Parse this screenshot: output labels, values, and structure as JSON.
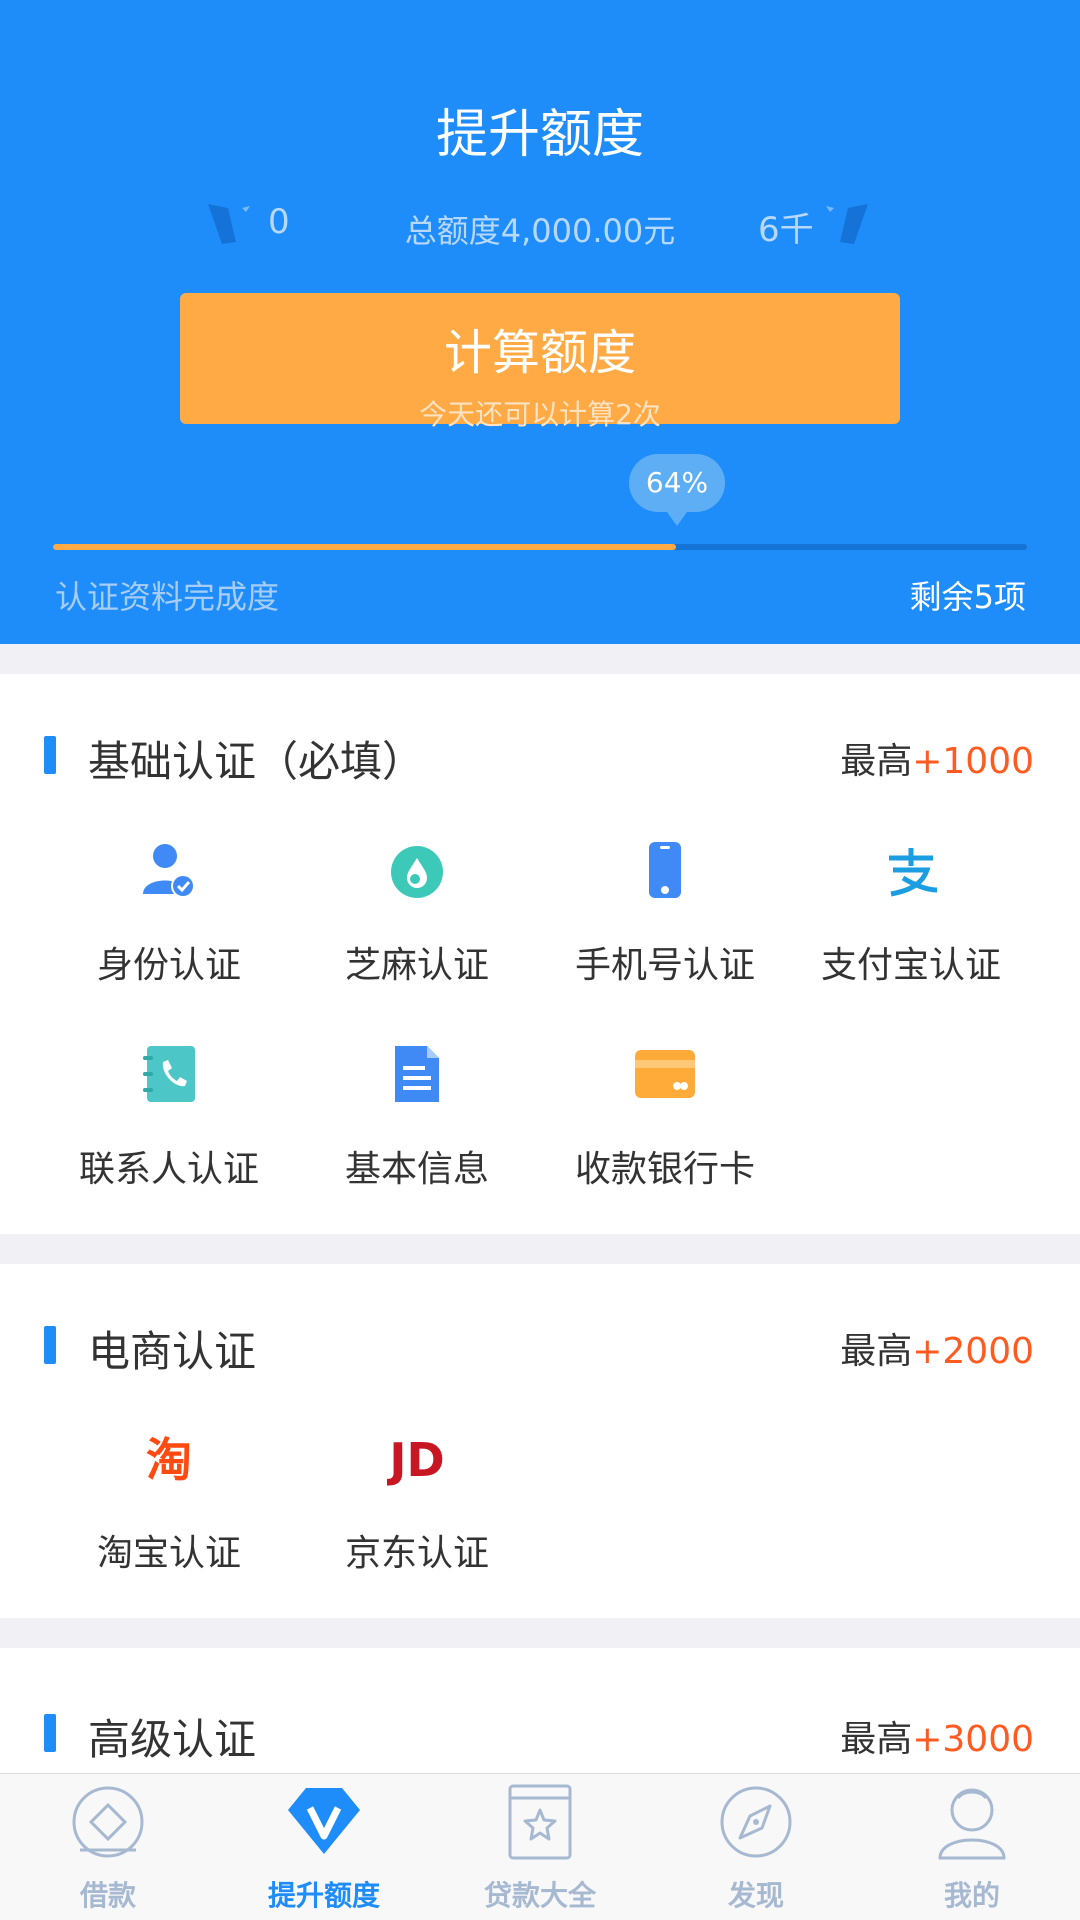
{
  "header": {
    "title": "提升额度",
    "range_min": "0",
    "range_total": "总额度4,000.00元",
    "range_max": "6千",
    "calc_button": {
      "label": "计算额度",
      "sub": "今天还可以计算2次"
    },
    "progress": {
      "percent_label": "64%",
      "value": 0.64,
      "label": "认证资料完成度",
      "remaining": "剩余5项"
    }
  },
  "sections": {
    "basic": {
      "title": "基础认证（必填）",
      "max_prefix": "最高",
      "max_value": "+1000",
      "items": [
        {
          "label": "身份认证",
          "icon": "id-user-check-icon"
        },
        {
          "label": "芝麻认证",
          "icon": "sesame-drop-icon"
        },
        {
          "label": "手机号认证",
          "icon": "phone-icon"
        },
        {
          "label": "支付宝认证",
          "icon": "alipay-icon"
        },
        {
          "label": "联系人认证",
          "icon": "contacts-book-icon"
        },
        {
          "label": "基本信息",
          "icon": "document-icon"
        },
        {
          "label": "收款银行卡",
          "icon": "bank-card-icon"
        }
      ]
    },
    "ecommerce": {
      "title": "电商认证",
      "max_prefix": "最高",
      "max_value": "+2000",
      "items": [
        {
          "label": "淘宝认证",
          "icon": "taobao-icon",
          "glyph": "淘"
        },
        {
          "label": "京东认证",
          "icon": "jd-icon",
          "glyph": "JD"
        }
      ]
    },
    "advanced": {
      "title": "高级认证",
      "max_prefix": "最高",
      "max_value": "+3000"
    }
  },
  "tabbar": {
    "items": [
      {
        "label": "借款",
        "icon": "loan-coin-icon",
        "active": false
      },
      {
        "label": "提升额度",
        "icon": "vip-diamond-icon",
        "active": true
      },
      {
        "label": "贷款大全",
        "icon": "star-book-icon",
        "active": false
      },
      {
        "label": "发现",
        "icon": "compass-icon",
        "active": false
      },
      {
        "label": "我的",
        "icon": "profile-icon",
        "active": false
      }
    ]
  },
  "colors": {
    "primary": "#1e8dfa",
    "accent": "#ffaa45",
    "highlight": "#ff5a1f",
    "tab_inactive": "#a6b9d1"
  }
}
